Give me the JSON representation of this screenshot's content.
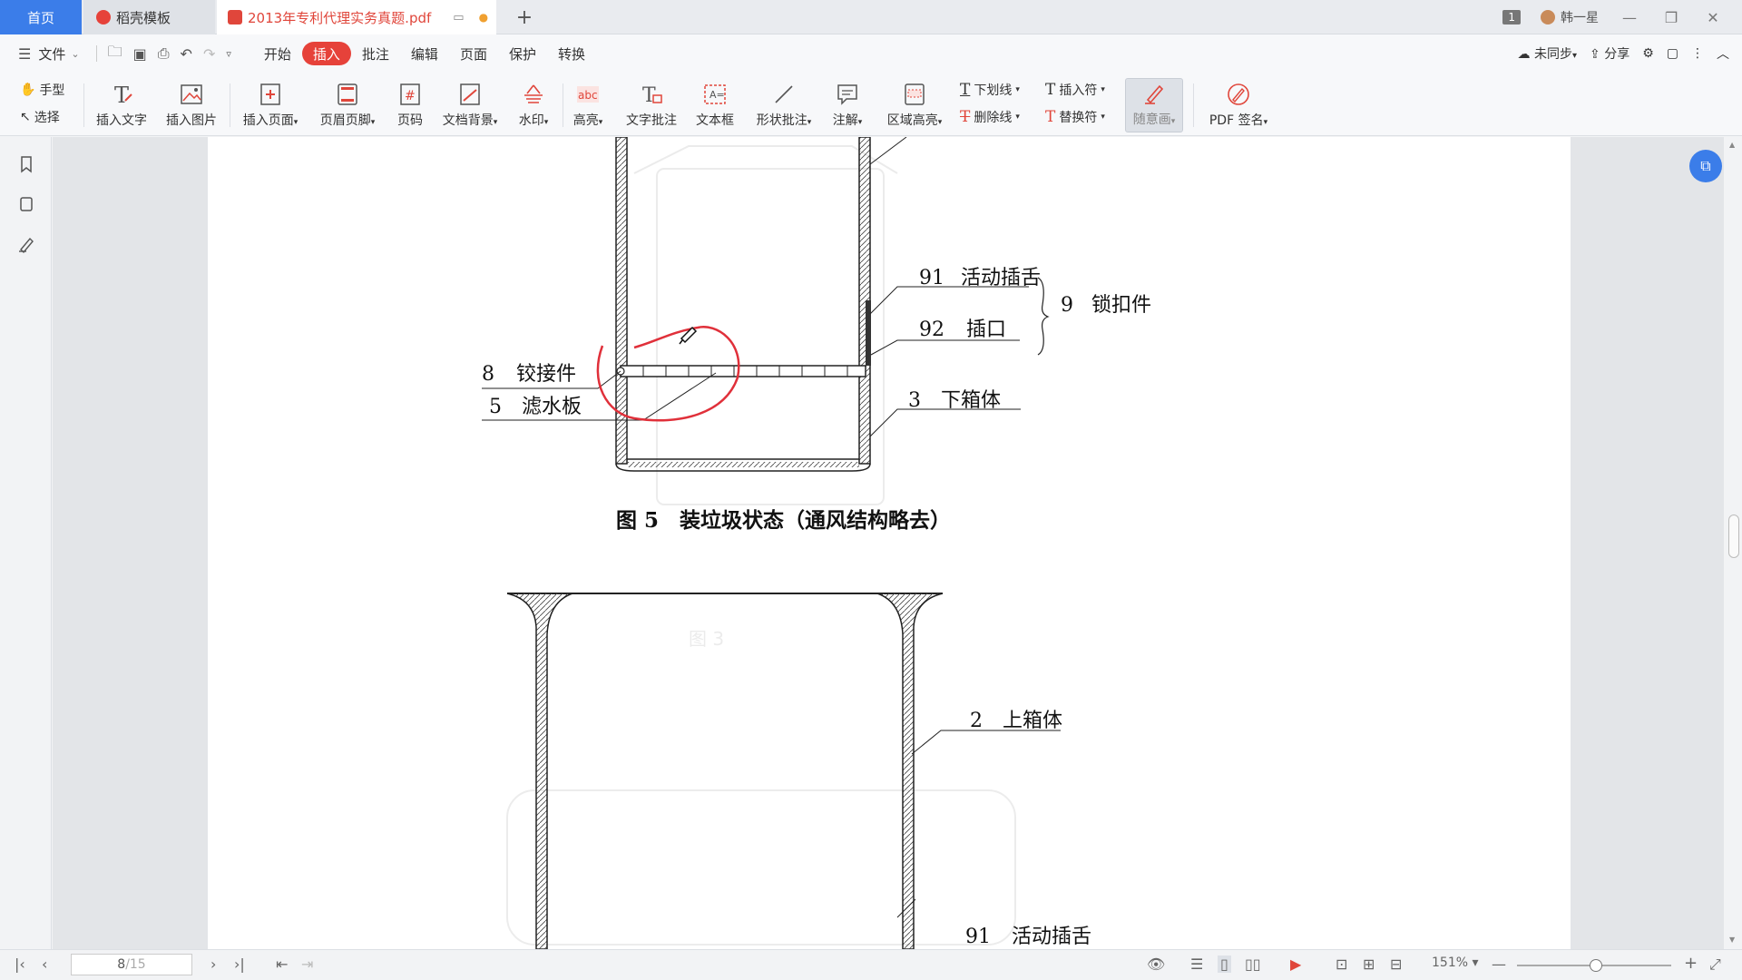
{
  "tabs": {
    "home": "首页",
    "template": "稻壳模板",
    "file": "2013年专利代理实务真题.pdf"
  },
  "window": {
    "badge": "1",
    "user": "韩一星"
  },
  "menu": {
    "file": "文件",
    "items": [
      "开始",
      "插入",
      "批注",
      "编辑",
      "页面",
      "保护",
      "转换"
    ],
    "active": "插入",
    "sync": "未同步",
    "share": "分享"
  },
  "ribbon": {
    "hand": "手型",
    "select": "选择",
    "insert_text": "插入文字",
    "insert_image": "插入图片",
    "insert_page": "插入页面",
    "header_footer": "页眉页脚",
    "page_number": "页码",
    "doc_background": "文档背景",
    "watermark": "水印",
    "highlight": "高亮",
    "text_comment": "文字批注",
    "text_box": "文本框",
    "shape_comment": "形状批注",
    "annotation": "注解",
    "area_highlight": "区域高亮",
    "underline": "下划线",
    "strikethrough": "删除线",
    "insert_mark": "插入符",
    "replace_mark": "替换符",
    "freehand": "随意画",
    "pdf_sign": "PDF 签名"
  },
  "figure": {
    "labels": {
      "l91": "91",
      "l91_text": "活动插舌",
      "l9": "9",
      "l9_text": "锁扣件",
      "l92": "92",
      "l92_text": "插口",
      "l8": "8",
      "l8_text": "铰接件",
      "l5": "5",
      "l5_text": "滤水板",
      "l3": "3",
      "l3_text": "下箱体",
      "l2": "2",
      "l2_text": "上箱体",
      "l91b": "91",
      "l91b_text": "活动插舌"
    },
    "caption": "图 5　装垃圾状态（通风结构略去）"
  },
  "status": {
    "page_current": "8",
    "page_total": "/15",
    "zoom": "151%"
  },
  "colors": {
    "accent": "#e6423a",
    "home_tab": "#3b7de9",
    "ink": "#e0303a"
  }
}
